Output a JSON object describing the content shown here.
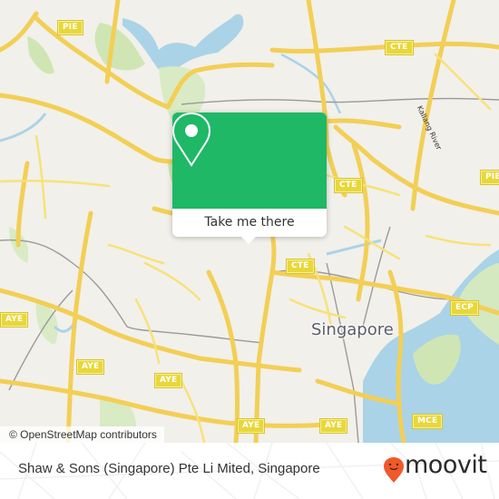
{
  "map": {
    "city_label": "Singapore",
    "river_label": "Kallang River",
    "road_shields": [
      {
        "id": "pie-nw",
        "label": "PIE"
      },
      {
        "id": "pie-e",
        "label": "PIE"
      },
      {
        "id": "cte-n",
        "label": "CTE"
      },
      {
        "id": "cte-mid",
        "label": "CTE"
      },
      {
        "id": "cte-s",
        "label": "CTE"
      },
      {
        "id": "ecp",
        "label": "ECP"
      },
      {
        "id": "mce",
        "label": "MCE"
      },
      {
        "id": "aye-w",
        "label": "AYE"
      },
      {
        "id": "aye-1",
        "label": "AYE"
      },
      {
        "id": "aye-2",
        "label": "AYE"
      },
      {
        "id": "aye-3",
        "label": "AYE"
      },
      {
        "id": "aye-4",
        "label": "AYE"
      }
    ],
    "attribution": "© OpenStreetMap contributors",
    "colors": {
      "land": "#f2f0ea",
      "water": "#aad3e8",
      "park": "#cfe6b4",
      "road": "#f7e27a",
      "shield": "#e8d73a"
    }
  },
  "popup": {
    "icon": "map-pin-icon",
    "button_label": "Take me there",
    "color": "#1eb866"
  },
  "footer": {
    "place_name": "Shaw & Sons (Singapore) Pte Li Mited, Singapore",
    "brand": "moovit",
    "brand_color": "#f0592a"
  }
}
